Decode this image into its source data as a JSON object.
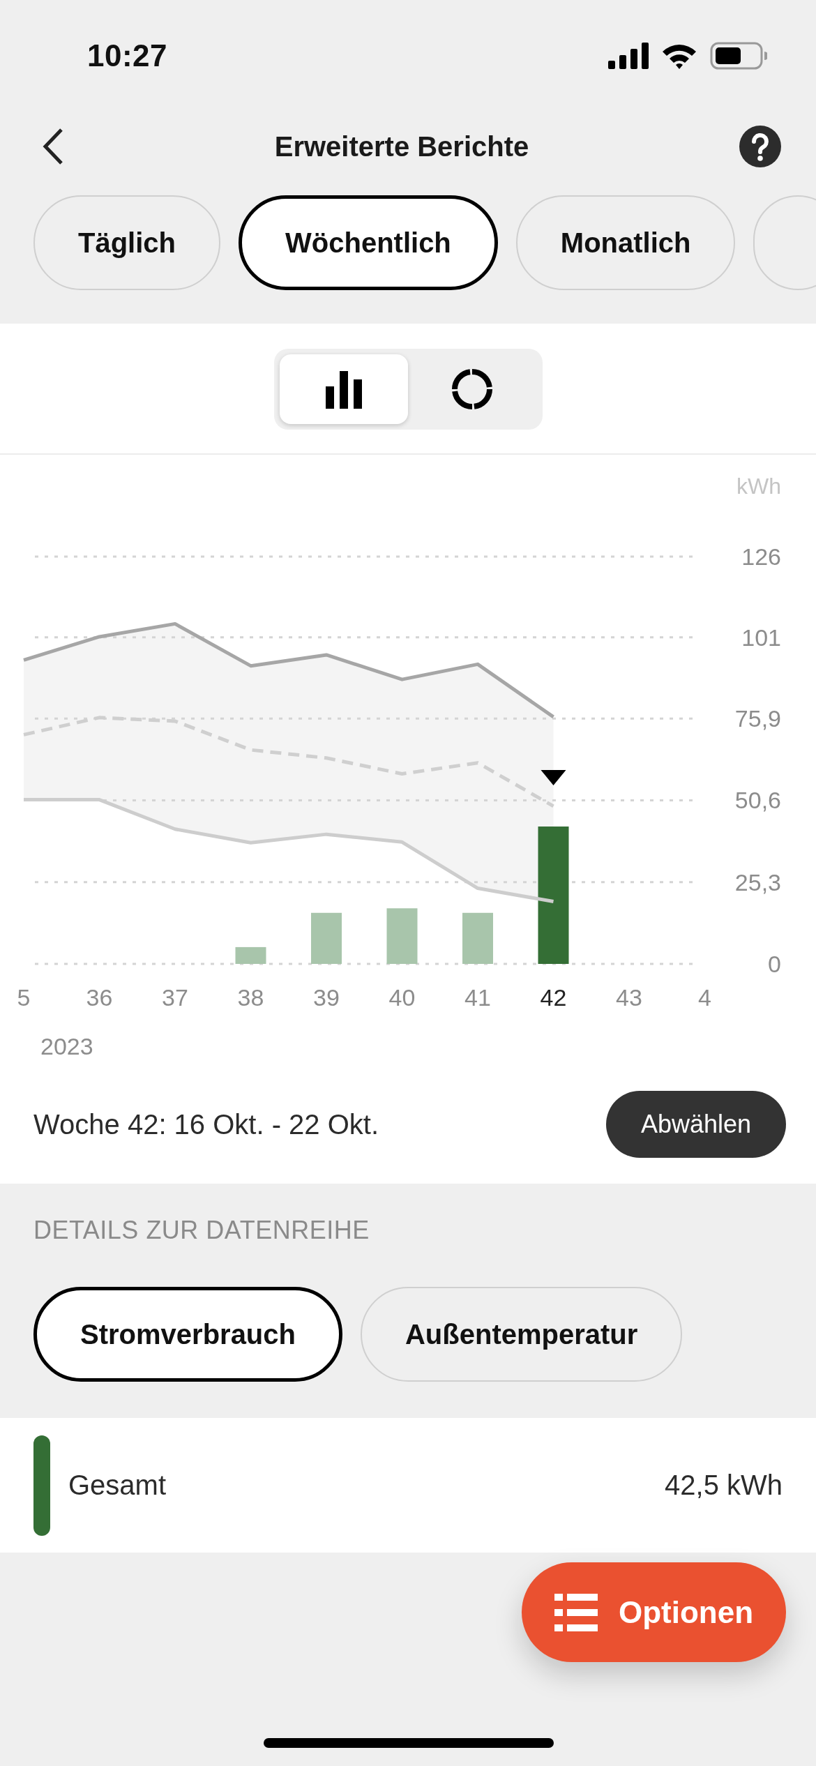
{
  "status_bar": {
    "time": "10:27"
  },
  "nav": {
    "title": "Erweiterte Berichte"
  },
  "period_tabs": [
    {
      "label": "Täglich",
      "selected": false
    },
    {
      "label": "Wöchentlich",
      "selected": true
    },
    {
      "label": "Monatlich",
      "selected": false
    }
  ],
  "view_toggle": [
    {
      "kind": "bars",
      "selected": true
    },
    {
      "kind": "donut",
      "selected": false
    }
  ],
  "consumption_chart": {
    "chart_data": {
      "type": "bar",
      "ylabel": "kWh",
      "xlabel": "2023",
      "grid": true,
      "categories": [
        "5",
        "36",
        "37",
        "38",
        "39",
        "40",
        "41",
        "42",
        "43",
        "4"
      ],
      "ylim": [
        0,
        126
      ],
      "yticks": [
        {
          "value": 0,
          "label": "0"
        },
        {
          "value": 25.3,
          "label": "25,3"
        },
        {
          "value": 50.6,
          "label": "50,6"
        },
        {
          "value": 75.9,
          "label": "75,9"
        },
        {
          "value": 101,
          "label": "101"
        },
        {
          "value": 126,
          "label": "126"
        }
      ],
      "series": [
        {
          "color": "#a8c5ab",
          "values": [
            null,
            null,
            null,
            5.2,
            15.8,
            17.2,
            15.8,
            null,
            null,
            null
          ]
        },
        {
          "color": "#346e35",
          "values": [
            null,
            null,
            null,
            null,
            null,
            null,
            null,
            42.5,
            null,
            null
          ]
        }
      ]
    }
  },
  "comparison_chart": {
    "chart_data": {
      "type": "line",
      "ylim": [
        0,
        126
      ],
      "series": [
        {
          "color": "#a6a6a6",
          "line_style": "solid",
          "values": [
            94,
            101.2,
            105.2,
            92.2,
            95.6,
            88,
            92.7,
            76.4,
            null,
            null
          ]
        },
        {
          "color": "#cfcfcf",
          "line_style": "dashed",
          "values": [
            70.9,
            76.2,
            75.1,
            66.2,
            63.7,
            58.8,
            62.2,
            48.8,
            null,
            null
          ]
        },
        {
          "color": "#cdcdcd",
          "line_style": "solid",
          "values": [
            50.8,
            50.8,
            41.7,
            37.5,
            40.1,
            37.7,
            23.4,
            19.3,
            null,
            null
          ]
        }
      ]
    }
  },
  "selection": {
    "label": "Woche 42: 16 Okt. - 22 Okt.",
    "button": "Abwählen"
  },
  "details": {
    "heading": "DETAILS ZUR DATENREIHE",
    "tabs": [
      {
        "label": "Stromverbrauch",
        "selected": true
      },
      {
        "label": "Außentemperatur",
        "selected": false
      }
    ],
    "rows": [
      {
        "label": "Gesamt",
        "value": "42,5 kWh",
        "color": "#346e35"
      }
    ]
  },
  "fab": {
    "label": "Optionen"
  }
}
